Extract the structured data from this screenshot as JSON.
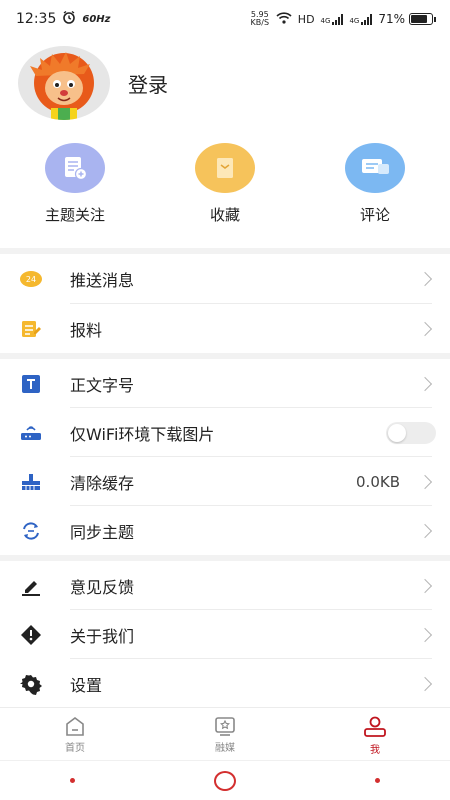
{
  "status_bar": {
    "time": "12:35",
    "refresh_rate": "60Hz",
    "net_speed_value": "5.95",
    "net_speed_unit": "KB/S",
    "hd_label": "HD",
    "signal1_label": "4G",
    "signal2_label": "4G",
    "battery": "71%"
  },
  "profile": {
    "login_label": "登录"
  },
  "quick_actions": [
    {
      "label": "主题关注",
      "icon": "topic-follow-icon",
      "color": "#a9b4f0"
    },
    {
      "label": "收藏",
      "icon": "favorites-icon",
      "color": "#f6c35b"
    },
    {
      "label": "评论",
      "icon": "comment-icon",
      "color": "#7cb8f2"
    }
  ],
  "menu": {
    "push": "推送消息",
    "report": "报料",
    "font_size": "正文字号",
    "wifi_images": "仅WiFi环境下载图片",
    "clear_cache": "清除缓存",
    "cache_size": "0.0KB",
    "sync_topics": "同步主题",
    "feedback": "意见反馈",
    "about": "关于我们",
    "settings": "设置"
  },
  "tabbar": {
    "home": "首页",
    "media": "融媒",
    "me": "我"
  },
  "colors": {
    "accent": "#c0151f",
    "icon_blue": "#2e63c4"
  }
}
